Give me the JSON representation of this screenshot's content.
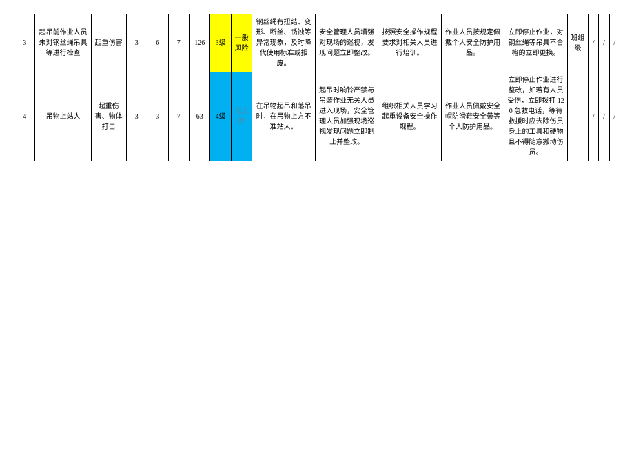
{
  "rows": [
    {
      "no": "3",
      "desc": "起吊前作业人员未对钢丝绳吊具等进行检查",
      "harm": "起重伤害",
      "L": "3",
      "E": "6",
      "C": "7",
      "D": "126",
      "level": "3级",
      "risk": "一般风险",
      "m1": "钢丝绳有扭结、变形、断丝、锈蚀等异常现象，及时降代使用标准或报废。",
      "m2": "安全管理人员增强对现场的巡视，发现问题立即整改。",
      "m3": "按照安全操作规程要求对相关人员进行培训。",
      "m4": "作业人员按规定佩戴个人安全防护用品。",
      "m5": "立即停止作业，对钢丝绳等吊具不合格的立即更换。",
      "lvl2": "班组级",
      "s1": "/",
      "s2": "/",
      "s3": "/"
    },
    {
      "no": "4",
      "desc": "吊物上站人",
      "harm": "起重伤害、物体打击",
      "L": "3",
      "E": "3",
      "C": "7",
      "D": "63",
      "level": "4级",
      "risk": "低风险",
      "m1": "在吊物起吊和落吊时，在吊物上方不准站人。",
      "m2": "起吊时响铃严禁与吊装作业无关人员进入现场，安全管理人员加强现场巡视发现问题立即制止并整改。",
      "m3": "组织相关人员学习起重设备安全操作规程。",
      "m4": "作业人员佩戴安全帽防滑鞋安全带等个人防护用品。",
      "m5": "立即停止作业进行整改，如若有人员受伤，立即拨打 120 急救电话，等待救援时应去除伤员身上的工具和硬物且不得随意搬动伤员。",
      "lvl2": "",
      "s1": "/",
      "s2": "/",
      "s3": "/"
    }
  ]
}
